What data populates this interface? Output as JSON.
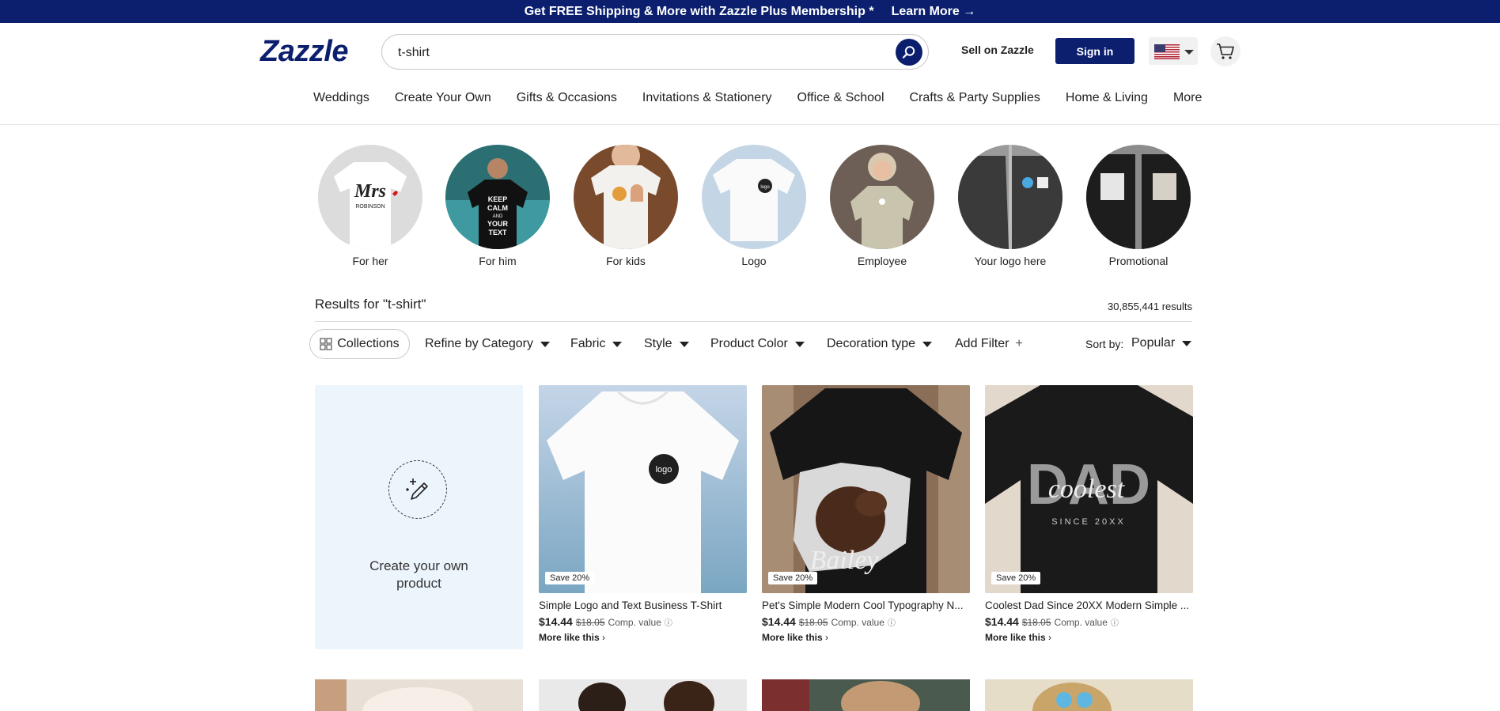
{
  "promo": {
    "text": "Get FREE Shipping & More with Zazzle Plus Membership *",
    "link": "Learn More →"
  },
  "header": {
    "logo": "Zazzle",
    "search_value": "t-shirt",
    "sell": "Sell on Zazzle",
    "signin": "Sign in"
  },
  "nav": [
    "Weddings",
    "Create Your Own",
    "Gifts & Occasions",
    "Invitations & Stationery",
    "Office & School",
    "Crafts & Party Supplies",
    "Home & Living",
    "More"
  ],
  "categories": [
    "For her",
    "For him",
    "For kids",
    "Logo",
    "Employee",
    "Your logo here",
    "Promotional"
  ],
  "results": {
    "title": "Results for \"t-shirt\"",
    "count": "30,855,441 results"
  },
  "filters": {
    "collections": "Collections",
    "items": [
      "Refine by Category",
      "Fabric",
      "Style",
      "Product Color",
      "Decoration type"
    ],
    "add_filter": "Add Filter",
    "sort_label": "Sort by:",
    "sort_value": "Popular"
  },
  "create_tile": {
    "text": "Create your own product"
  },
  "products": [
    {
      "badge": "Save 20%",
      "name": "Simple Logo and Text Business T-Shirt",
      "price": "$14.44",
      "was": "$18.05",
      "comp": "Comp. value",
      "more": "More like this"
    },
    {
      "badge": "Save 20%",
      "name": "Pet's Simple Modern Cool Typography N...",
      "price": "$14.44",
      "was": "$18.05",
      "comp": "Comp. value",
      "more": "More like this"
    },
    {
      "badge": "Save 20%",
      "name": "Coolest Dad Since 20XX Modern Simple ...",
      "price": "$14.44",
      "was": "$18.05",
      "comp": "Comp. value",
      "more": "More like this"
    }
  ],
  "artwork": {
    "mrs": "Mrs",
    "robinson": "ROBINSON",
    "keep_calm": [
      "KEEP",
      "CALM",
      "AND",
      "YOUR",
      "TEXT"
    ],
    "logo": "logo",
    "bailey": "Bailey",
    "dad": "DAD",
    "coolest": "coolest",
    "since": "SINCE 20XX"
  },
  "colors": {
    "brand": "#0b1f6e",
    "create_bg": "#edf5fc"
  }
}
